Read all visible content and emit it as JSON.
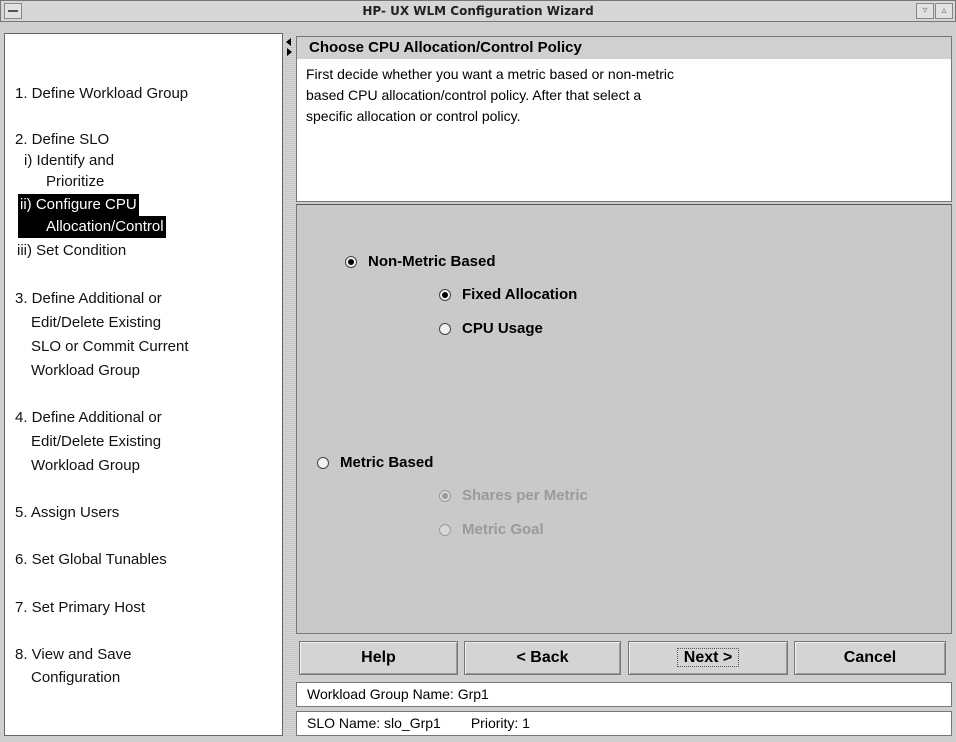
{
  "window": {
    "title": "HP- UX WLM Configuration Wizard",
    "buttons": {
      "minimize": "▿",
      "maximize": "▵"
    }
  },
  "steps": {
    "s1": "1. Define Workload Group",
    "s2": "2. Define SLO",
    "s2i_a": "i) Identify and",
    "s2i_b": "Prioritize",
    "s2ii_a": "ii) Configure CPU",
    "s2ii_b": "Allocation/Control",
    "s2iii": "iii) Set Condition",
    "s3_a": "3. Define Additional or",
    "s3_b": "Edit/Delete Existing",
    "s3_c": "SLO or Commit Current",
    "s3_d": "Workload Group",
    "s4_a": "4. Define Additional or",
    "s4_b": "Edit/Delete Existing",
    "s4_c": "Workload Group",
    "s5": "5. Assign Users",
    "s6": "6. Set Global Tunables",
    "s7": "7. Set Primary Host",
    "s8_a": "8. View and Save",
    "s8_b": "Configuration"
  },
  "panel": {
    "heading": "Choose CPU Allocation/Control Policy",
    "desc_1": "First decide whether you want a metric based or non-metric",
    "desc_2": "based CPU allocation/control policy. After that select a",
    "desc_3": "specific allocation or control policy."
  },
  "options": {
    "non_metric": "Non-Metric Based",
    "fixed": "Fixed Allocation",
    "cpu_usage": "CPU Usage",
    "metric": "Metric Based",
    "shares": "Shares per Metric",
    "goal": "Metric Goal"
  },
  "buttons": {
    "help": "Help",
    "back": "< Back",
    "next": "Next >",
    "cancel": "Cancel"
  },
  "status": {
    "group_name": "Workload Group Name: Grp1",
    "slo_name": "SLO Name: slo_Grp1",
    "priority": "Priority: 1"
  }
}
